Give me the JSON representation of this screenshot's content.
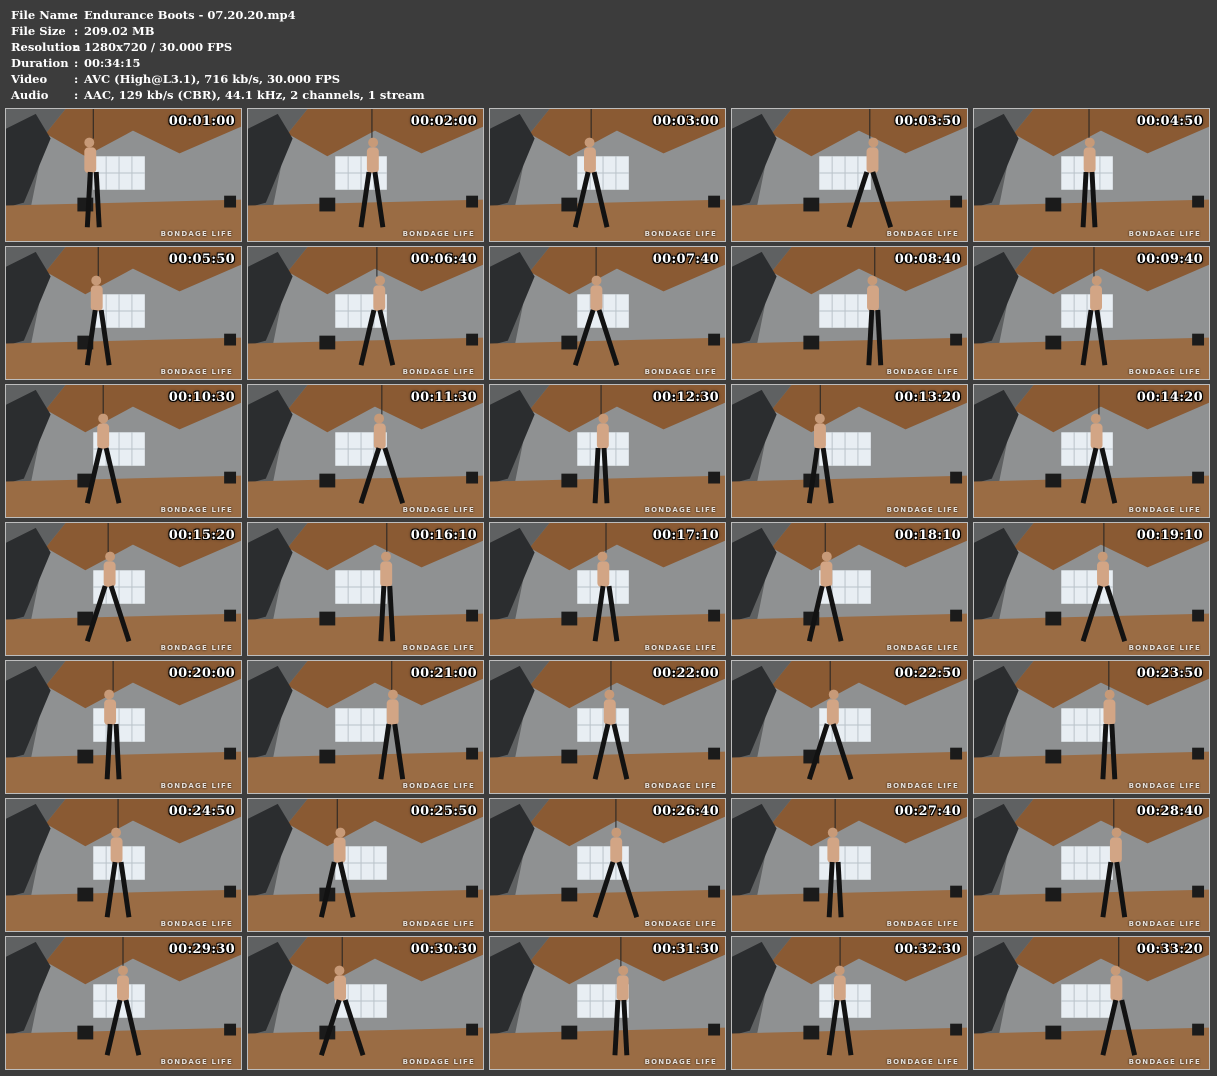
{
  "info": [
    {
      "label": "File Name",
      "sep": ":",
      "value": "Endurance Boots - 07.20.20.mp4"
    },
    {
      "label": "File Size",
      "sep": ":",
      "value": "209.02 MB"
    },
    {
      "label": "Resolution",
      "sep": ":",
      "value": "1280x720 / 30.000 FPS"
    },
    {
      "label": "Duration",
      "sep": ":",
      "value": "00:34:15"
    },
    {
      "label": "Video",
      "sep": ":",
      "value": "AVC (High@L3.1), 716 kb/s, 30.000 FPS"
    },
    {
      "label": "Audio",
      "sep": ":",
      "value": "AAC, 129 kb/s (CBR), 44.1 kHz, 2 channels, 1 stream"
    }
  ],
  "watermark": "BONDAGE LIFE",
  "timestamps": [
    "00:01:00",
    "00:02:00",
    "00:03:00",
    "00:03:50",
    "00:04:50",
    "00:05:50",
    "00:06:40",
    "00:07:40",
    "00:08:40",
    "00:09:40",
    "00:10:30",
    "00:11:30",
    "00:12:30",
    "00:13:20",
    "00:14:20",
    "00:15:20",
    "00:16:10",
    "00:17:10",
    "00:18:10",
    "00:19:10",
    "00:20:00",
    "00:21:00",
    "00:22:00",
    "00:22:50",
    "00:23:50",
    "00:24:50",
    "00:25:50",
    "00:26:40",
    "00:27:40",
    "00:28:40",
    "00:29:30",
    "00:30:30",
    "00:31:30",
    "00:32:30",
    "00:33:20"
  ],
  "colors": {
    "background": "#3c3c3c",
    "text": "#ffffff",
    "ceiling": "#8a5a33",
    "wall": "#8f9192",
    "floor": "#9a6c44",
    "window": "#e8eef3",
    "figure": "#121212"
  }
}
